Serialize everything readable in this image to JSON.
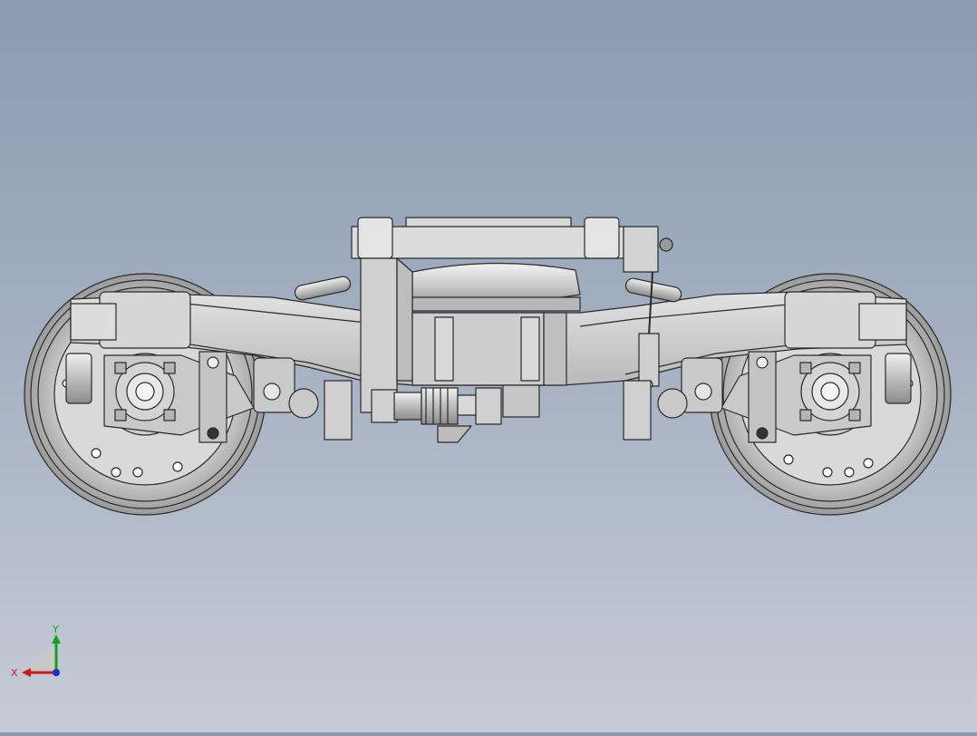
{
  "triad": {
    "x_label": "X",
    "y_label": "Y",
    "x_color": "#d01818",
    "y_color": "#18a018",
    "z_color": "#1830c8"
  },
  "colors": {
    "background_top": "#8a9bb0",
    "background_bottom": "#c6cbd6",
    "metal": "#d2d2d2",
    "metal_dark": "#a8a8a8",
    "edge": "#2a2a2a"
  }
}
